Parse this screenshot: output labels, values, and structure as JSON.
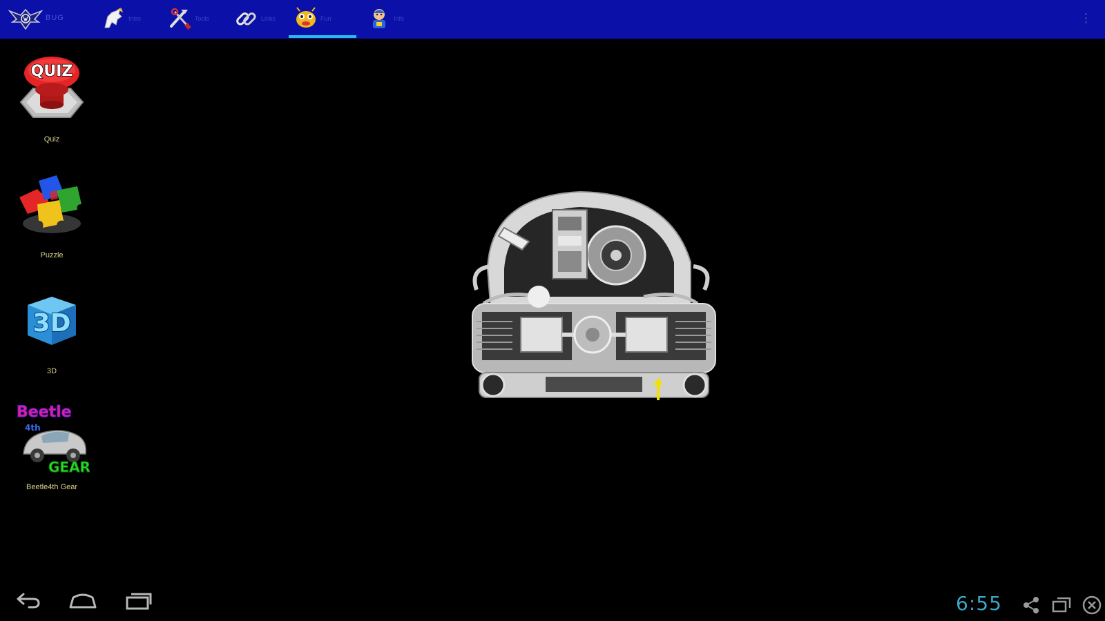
{
  "app": {
    "title": "BUG",
    "logo_icon": "vw-eagle-logo-icon"
  },
  "tabs": [
    {
      "label": "Intro",
      "icon": "horse-emblem-icon",
      "active": false
    },
    {
      "label": "Tools",
      "icon": "tools-icon",
      "active": false
    },
    {
      "label": "Links",
      "icon": "chain-link-icon",
      "active": false
    },
    {
      "label": "Fun",
      "icon": "bug-character-icon",
      "active": true
    },
    {
      "label": "Info",
      "icon": "cartoon-character-icon",
      "active": false
    }
  ],
  "launcher": [
    {
      "label": "Quiz",
      "icon": "quiz-button-icon",
      "icon_text": "QUIZ"
    },
    {
      "label": "Puzzle",
      "icon": "puzzle-pieces-icon"
    },
    {
      "label": "3D",
      "icon": "3d-cube-icon",
      "icon_text": "3D"
    },
    {
      "label": "Beetle4th Gear",
      "icon": "beetle-4th-gear-icon",
      "icon_text_top": "Beetle",
      "icon_text_mid": "4th",
      "icon_text_bottom": "GEAR"
    }
  ],
  "main": {
    "image": "vw-boxer-engine-image"
  },
  "system_bar": {
    "time": "6:55",
    "nav": [
      "back-icon",
      "home-icon",
      "recent-apps-icon"
    ],
    "tray": [
      "share-icon",
      "window-icon",
      "close-circle-icon"
    ]
  },
  "colors": {
    "topbar": "#0a10a8",
    "indicator": "#2ab8ee",
    "label": "#d9d48c",
    "clock": "#3da7c9"
  }
}
